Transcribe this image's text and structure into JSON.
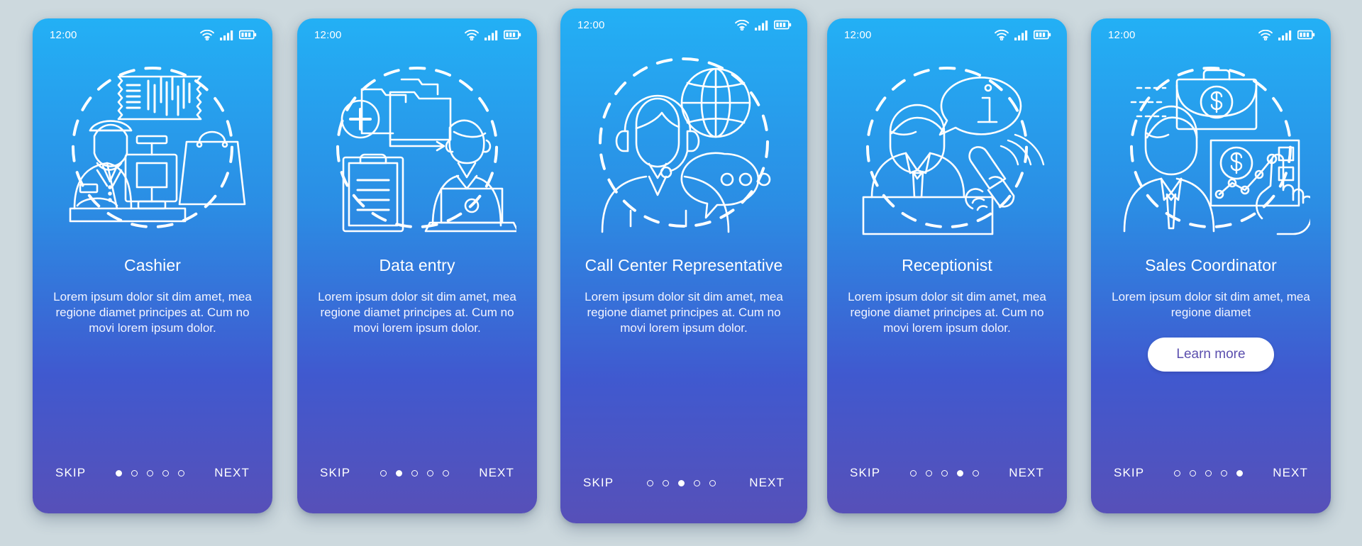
{
  "background_color": "#cdd9de",
  "shared": {
    "clock": "12:00",
    "skip_label": "SKIP",
    "next_label": "NEXT",
    "body_text_full": "Lorem ipsum dolor sit dim amet, mea regione diamet principes at. Cum no movi lorem ipsum dolor.",
    "body_text_short": "Lorem ipsum dolor sit dim amet, mea regione diamet",
    "status_icons": [
      "wifi-icon",
      "cellular-signal-icon",
      "battery-icon"
    ],
    "dot_count": 5,
    "accent_gradient_top": "#23b0f5",
    "accent_gradient_bottom": "#5750b8",
    "button_text_color": "#5b4fae"
  },
  "screens": [
    {
      "id": "cashier",
      "clock": "12:00",
      "title": "Cashier",
      "body": "Lorem ipsum dolor sit dim amet, mea regione diamet principes at. Cum no movi lorem ipsum dolor.",
      "illustration": "cashier-illustration",
      "illustration_parts": [
        "cashier-person",
        "cash-register",
        "receipt-barcode",
        "shopping-bag",
        "dashed-circle"
      ],
      "skip_label": "SKIP",
      "next_label": "NEXT",
      "active_dot": 1,
      "has_button": false,
      "button_label": ""
    },
    {
      "id": "data-entry",
      "clock": "12:00",
      "title": "Data entry",
      "body": "Lorem ipsum dolor sit dim amet, mea regione diamet principes at. Cum no movi lorem ipsum dolor.",
      "illustration": "data-entry-illustration",
      "illustration_parts": [
        "folder",
        "plus-circle",
        "arrow",
        "clipboard",
        "woman-with-laptop",
        "dashed-circle"
      ],
      "skip_label": "SKIP",
      "next_label": "NEXT",
      "active_dot": 2,
      "has_button": false,
      "button_label": ""
    },
    {
      "id": "call-center-representative",
      "clock": "12:00",
      "title": "Call Center Representative",
      "body": "Lorem ipsum dolor sit dim amet, mea regione diamet principes at. Cum no movi lorem ipsum dolor.",
      "illustration": "call-center-illustration",
      "illustration_parts": [
        "woman-with-headset",
        "globe",
        "chat-bubble-dots",
        "dashed-circle"
      ],
      "skip_label": "SKIP",
      "next_label": "NEXT",
      "active_dot": 3,
      "has_button": false,
      "button_label": ""
    },
    {
      "id": "receptionist",
      "clock": "12:00",
      "title": "Receptionist",
      "body": "Lorem ipsum dolor sit dim amet, mea regione diamet principes at. Cum no movi lorem ipsum dolor.",
      "illustration": "receptionist-illustration",
      "illustration_parts": [
        "man-at-desk",
        "info-speech-bubble",
        "hand-holding-phone",
        "dashed-circle"
      ],
      "skip_label": "SKIP",
      "next_label": "NEXT",
      "active_dot": 4,
      "has_button": false,
      "button_label": ""
    },
    {
      "id": "sales-coordinator",
      "clock": "12:00",
      "title": "Sales Coordinator",
      "body": "Lorem ipsum dolor sit dim amet, mea regione diamet",
      "illustration": "sales-coordinator-illustration",
      "illustration_parts": [
        "businessman",
        "briefcase-dollar",
        "chart-panel-dollar",
        "pointing-hand",
        "dashed-circle"
      ],
      "skip_label": "SKIP",
      "next_label": "NEXT",
      "active_dot": 5,
      "has_button": true,
      "button_label": "Learn more"
    }
  ]
}
